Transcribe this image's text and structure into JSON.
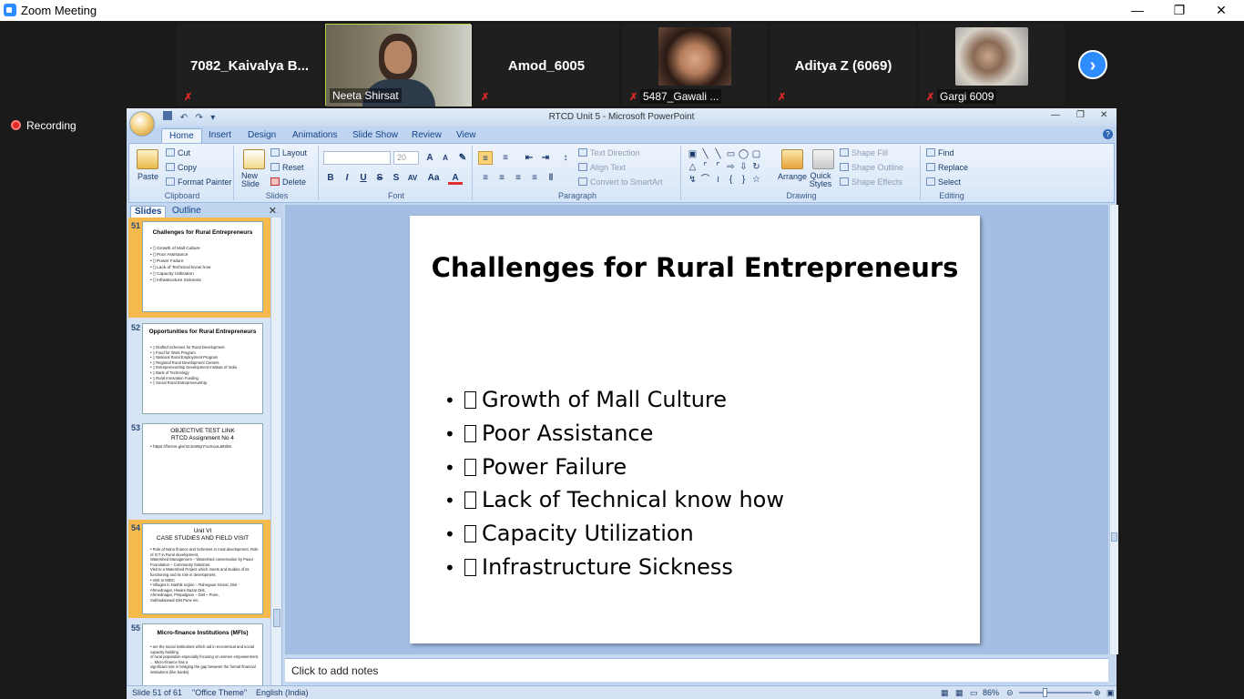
{
  "zoom": {
    "window_title": "Zoom Meeting",
    "recording_label": "Recording",
    "participants": [
      {
        "name": "7082_Kaivalya B...",
        "label": ""
      },
      {
        "name": "",
        "label": "Neeta Shirsat"
      },
      {
        "name": "Amod_6005",
        "label": ""
      },
      {
        "name": "",
        "label": "5487_Gawali ..."
      },
      {
        "name": "Aditya Z (6069)",
        "label": ""
      },
      {
        "name": "",
        "label": "Gargi 6009"
      }
    ],
    "next_icon": "chevron-right-icon"
  },
  "ppt": {
    "title": "RTCD Unit 5 - Microsoft PowerPoint",
    "tabs": [
      "Home",
      "Insert",
      "Design",
      "Animations",
      "Slide Show",
      "Review",
      "View"
    ],
    "clipboard": {
      "paste": "Paste",
      "cut": "Cut",
      "copy": "Copy",
      "format_painter": "Format Painter",
      "label": "Clipboard"
    },
    "slides_group": {
      "new_slide": "New Slide",
      "layout": "Layout",
      "reset": "Reset",
      "delete": "Delete",
      "label": "Slides"
    },
    "font_group": {
      "size": "20",
      "label": "Font"
    },
    "paragraph_group": {
      "text_direction": "Text Direction",
      "align_text": "Align Text",
      "convert_smartart": "Convert to SmartArt",
      "label": "Paragraph"
    },
    "drawing_group": {
      "arrange": "Arrange",
      "quick_styles": "Quick Styles",
      "shape_fill": "Shape Fill",
      "shape_outline": "Shape Outline",
      "shape_effects": "Shape Effects",
      "label": "Drawing"
    },
    "editing_group": {
      "find": "Find",
      "replace": "Replace",
      "select": "Select",
      "label": "Editing"
    },
    "pane_tabs": [
      "Slides",
      "Outline"
    ],
    "thumbnails": [
      {
        "num": "51",
        "title": "Challenges for Rural Entrepreneurs",
        "bullets": [
          "• ▯ Growth of Mall Culture",
          "• ▯ Poor Assistance",
          "• ▯ Power Failure",
          "• ▯ Lack of Technical know how",
          "• ▯ Capacity Utilization",
          "• ▯ Infrastructure Sickness"
        ]
      },
      {
        "num": "52",
        "title": "Opportunities for Rural Entrepreneurs",
        "bullets": [
          "• ▯ Drafted Schemes for Rural Development",
          "• ▯ Food for Work Program",
          "• ▯ National Rural Employment Program",
          "• ▯ Regional Rural Development Centers",
          "• ▯ Entrepreneurship Development Institute of India",
          "• ▯ Bank of Technology",
          "• ▯ Rural Innovation Funding",
          "• ▯ Social Rural Entrepreneurship."
        ]
      },
      {
        "num": "53",
        "title": "OBJECTIVE TEST LINK\nRTCD Assignment No 4",
        "bullets": [
          "• https://forms.gle/4zJosNpYnoXuuLBNb8"
        ]
      },
      {
        "num": "54",
        "title": "Unit VI\nCASE STUDIES AND FIELD VISIT",
        "bullets": [
          "• Role of Nano finance and Schemes in rural development, Role of ICT in Rural development,",
          "  Watershed Management – Watershed conservation by Paani Foundation – Community Solutions",
          "  Visit to a Watershed Project which meets and studies of its functioning and its role in development.",
          "• Visit to MIDC",
          "• Villages in Nashik region – Rahegaon-Sinnar, Dist - Ahmednagar, Hiware Bazar Dist.",
          "  Ahmednagar, Pimpalgaon – Dist – Pune,",
          "  Sukhadarwadi Dist Pune etc."
        ]
      },
      {
        "num": "55",
        "title": "Micro-finance Institutions (MFIs)",
        "bullets": [
          "• are the social institutions which aid in economical and social capacity building",
          "  of rural population especially focusing on women empowerment. ... Micro-finance has a",
          "  significant role in bridging the gap between the formal financial institutions (like banks)"
        ]
      }
    ],
    "slide": {
      "title": "Challenges for Rural Entrepreneurs",
      "bullets": [
        "Growth of Mall Culture",
        "Poor Assistance",
        "Power Failure",
        "Lack of Technical know how",
        "Capacity Utilization",
        "Infrastructure Sickness"
      ]
    },
    "notes_placeholder": "Click to add notes",
    "status": {
      "slide": "Slide 51 of 61",
      "theme": "\"Office Theme\"",
      "language": "English (India)",
      "zoom": "86%"
    }
  }
}
